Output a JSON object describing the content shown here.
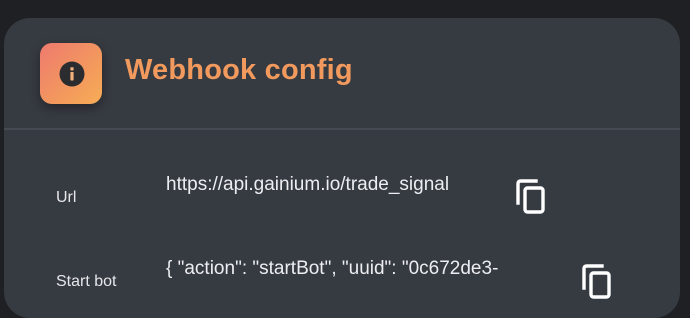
{
  "card": {
    "title": "Webhook config",
    "header_icon": "info-icon",
    "accent_color": "#f29a5e"
  },
  "rows": [
    {
      "label": "Url",
      "value": "https://api.gainium.io/trade_signal",
      "action_icon": "copy-icon"
    },
    {
      "label": "Start bot",
      "value": "{ \"action\": \"startBot\", \"uuid\": \"0c672de3-",
      "action_icon": "copy-icon"
    }
  ]
}
